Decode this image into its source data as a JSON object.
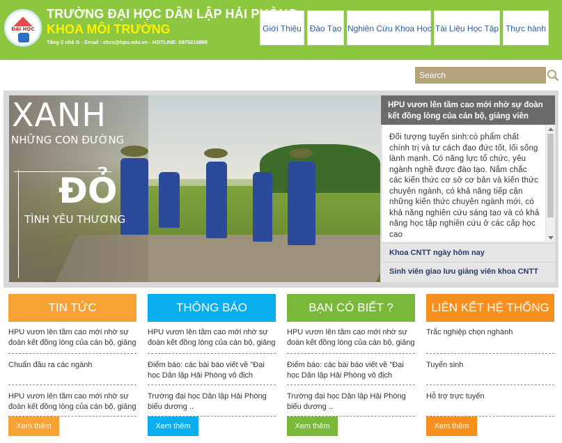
{
  "header": {
    "logo_text": "ĐẠI HỌC",
    "university": "TRƯỜNG ĐẠI HỌC DÂN LẬP HẢI PHÒNG",
    "faculty": "KHOA MÔI TRƯỜNG",
    "contact": "Tầng 2 nhà G - Email : cbcs@hpu.edu.vn - HOTLINE: 0975216895"
  },
  "nav": {
    "items": [
      "Giới Thiệu",
      "Đào Tạo",
      "Nghiên Cứu Khoa Học",
      "Tài Liệu Học Tập",
      "Thực hành"
    ]
  },
  "search": {
    "placeholder": "Search"
  },
  "slide": {
    "line1": "XANH",
    "line2": "NHỮNG CON ĐƯỜNG",
    "line3": "ĐỎ",
    "line4": "TÌNH YÊU THƯƠNG"
  },
  "side": {
    "title": "HPU vươn lên tầm cao mới nhờ sự đoàn kết đồng lòng của cán bộ, giảng viên",
    "body": "Đối tượng tuyển sinh:có phẩm chất chính trị và tư cách đạo đức tốt, lối sống lành mạnh. Có năng lực tổ chức, yêu ngành nghề được đào tạo. Nắm chắc các kiến thức cơ sở cơ bản và kiến thức chuyên ngành, có khả năng tiếp cận những kiến thức chuyên ngành mới, có khả năng nghiên cứu sáng tạo và có khả năng học tập nghiên cứu ở các cấp học cao",
    "items": [
      "Khoa CNTT ngày hôm nay",
      "Sinh viên giao lưu giảng viên khoa CNTT"
    ]
  },
  "columns": [
    {
      "heading": "TIN TỨC",
      "color": "#f7a234",
      "items": [
        "HPU vươn lên tầm cao mới nhờ sự đoàn kết đồng lòng của cán bộ, giảng",
        "Chuẩn đầu ra các ngành",
        "HPU vươn lên tầm cao mới nhờ sự đoàn kết đồng lòng của cán bộ, giảng"
      ],
      "more": "Xem thêm"
    },
    {
      "heading": "THÔNG BÁO",
      "color": "#0aaeef",
      "items": [
        "HPU vươn lên tầm cao mới nhờ sự đoàn kết đồng lòng của cán bộ, giảng",
        "Điểm báo: các bài báo viết về \"Đại học Dân lập Hải Phòng vô địch",
        "Trường đại học Dân lập Hải Phòng biểu dương .."
      ],
      "more": "Xem thêm"
    },
    {
      "heading": "BẠN CÓ BIẾT ?",
      "color": "#7ab83a",
      "items": [
        "HPU vươn lên tầm cao mới nhờ sự đoàn kết đồng lòng của cán bộ, giảng",
        "Điểm báo: các bài báo viết về \"Đại học Dân lập Hải Phòng vô địch",
        "Trường đại học Dân lập Hải Phòng biểu dương .."
      ],
      "more": "Xem thêm"
    },
    {
      "heading": "LIÊN KẾT HỆ THỐNG",
      "color": "#f7901e",
      "items": [
        "Trắc nghiệp chọn nghành",
        "Tuyển sinh",
        "Hỗ trợ trực tuyến"
      ],
      "more": "Xem thêm"
    }
  ]
}
